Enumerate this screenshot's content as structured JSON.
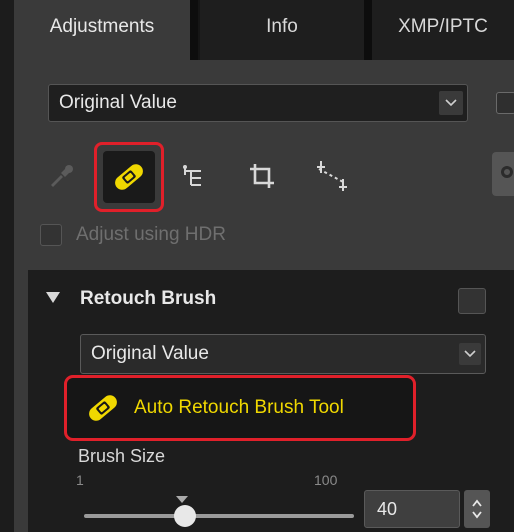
{
  "tabs": [
    {
      "label": "Adjustments",
      "active": true
    },
    {
      "label": "Info",
      "active": false
    },
    {
      "label": "XMP/IPTC",
      "active": false
    }
  ],
  "top_select": {
    "value": "Original Value"
  },
  "tools": [
    "color-picker-icon",
    "retouch-brush-icon",
    "levels-curves-icon",
    "crop-icon",
    "straighten-icon",
    "gear-icon"
  ],
  "hdr": {
    "label": "Adjust using HDR",
    "checked": false,
    "enabled": false
  },
  "retouch": {
    "title": "Retouch Brush",
    "select_value": "Original Value",
    "auto_tool_label": "Auto Retouch Brush Tool",
    "brush_size_label": "Brush Size",
    "min": "1",
    "max": "100",
    "value": "40",
    "slider_fraction": 0.39
  },
  "colors": {
    "highlight": "#e0202a",
    "accent_yellow": "#f0d800"
  }
}
